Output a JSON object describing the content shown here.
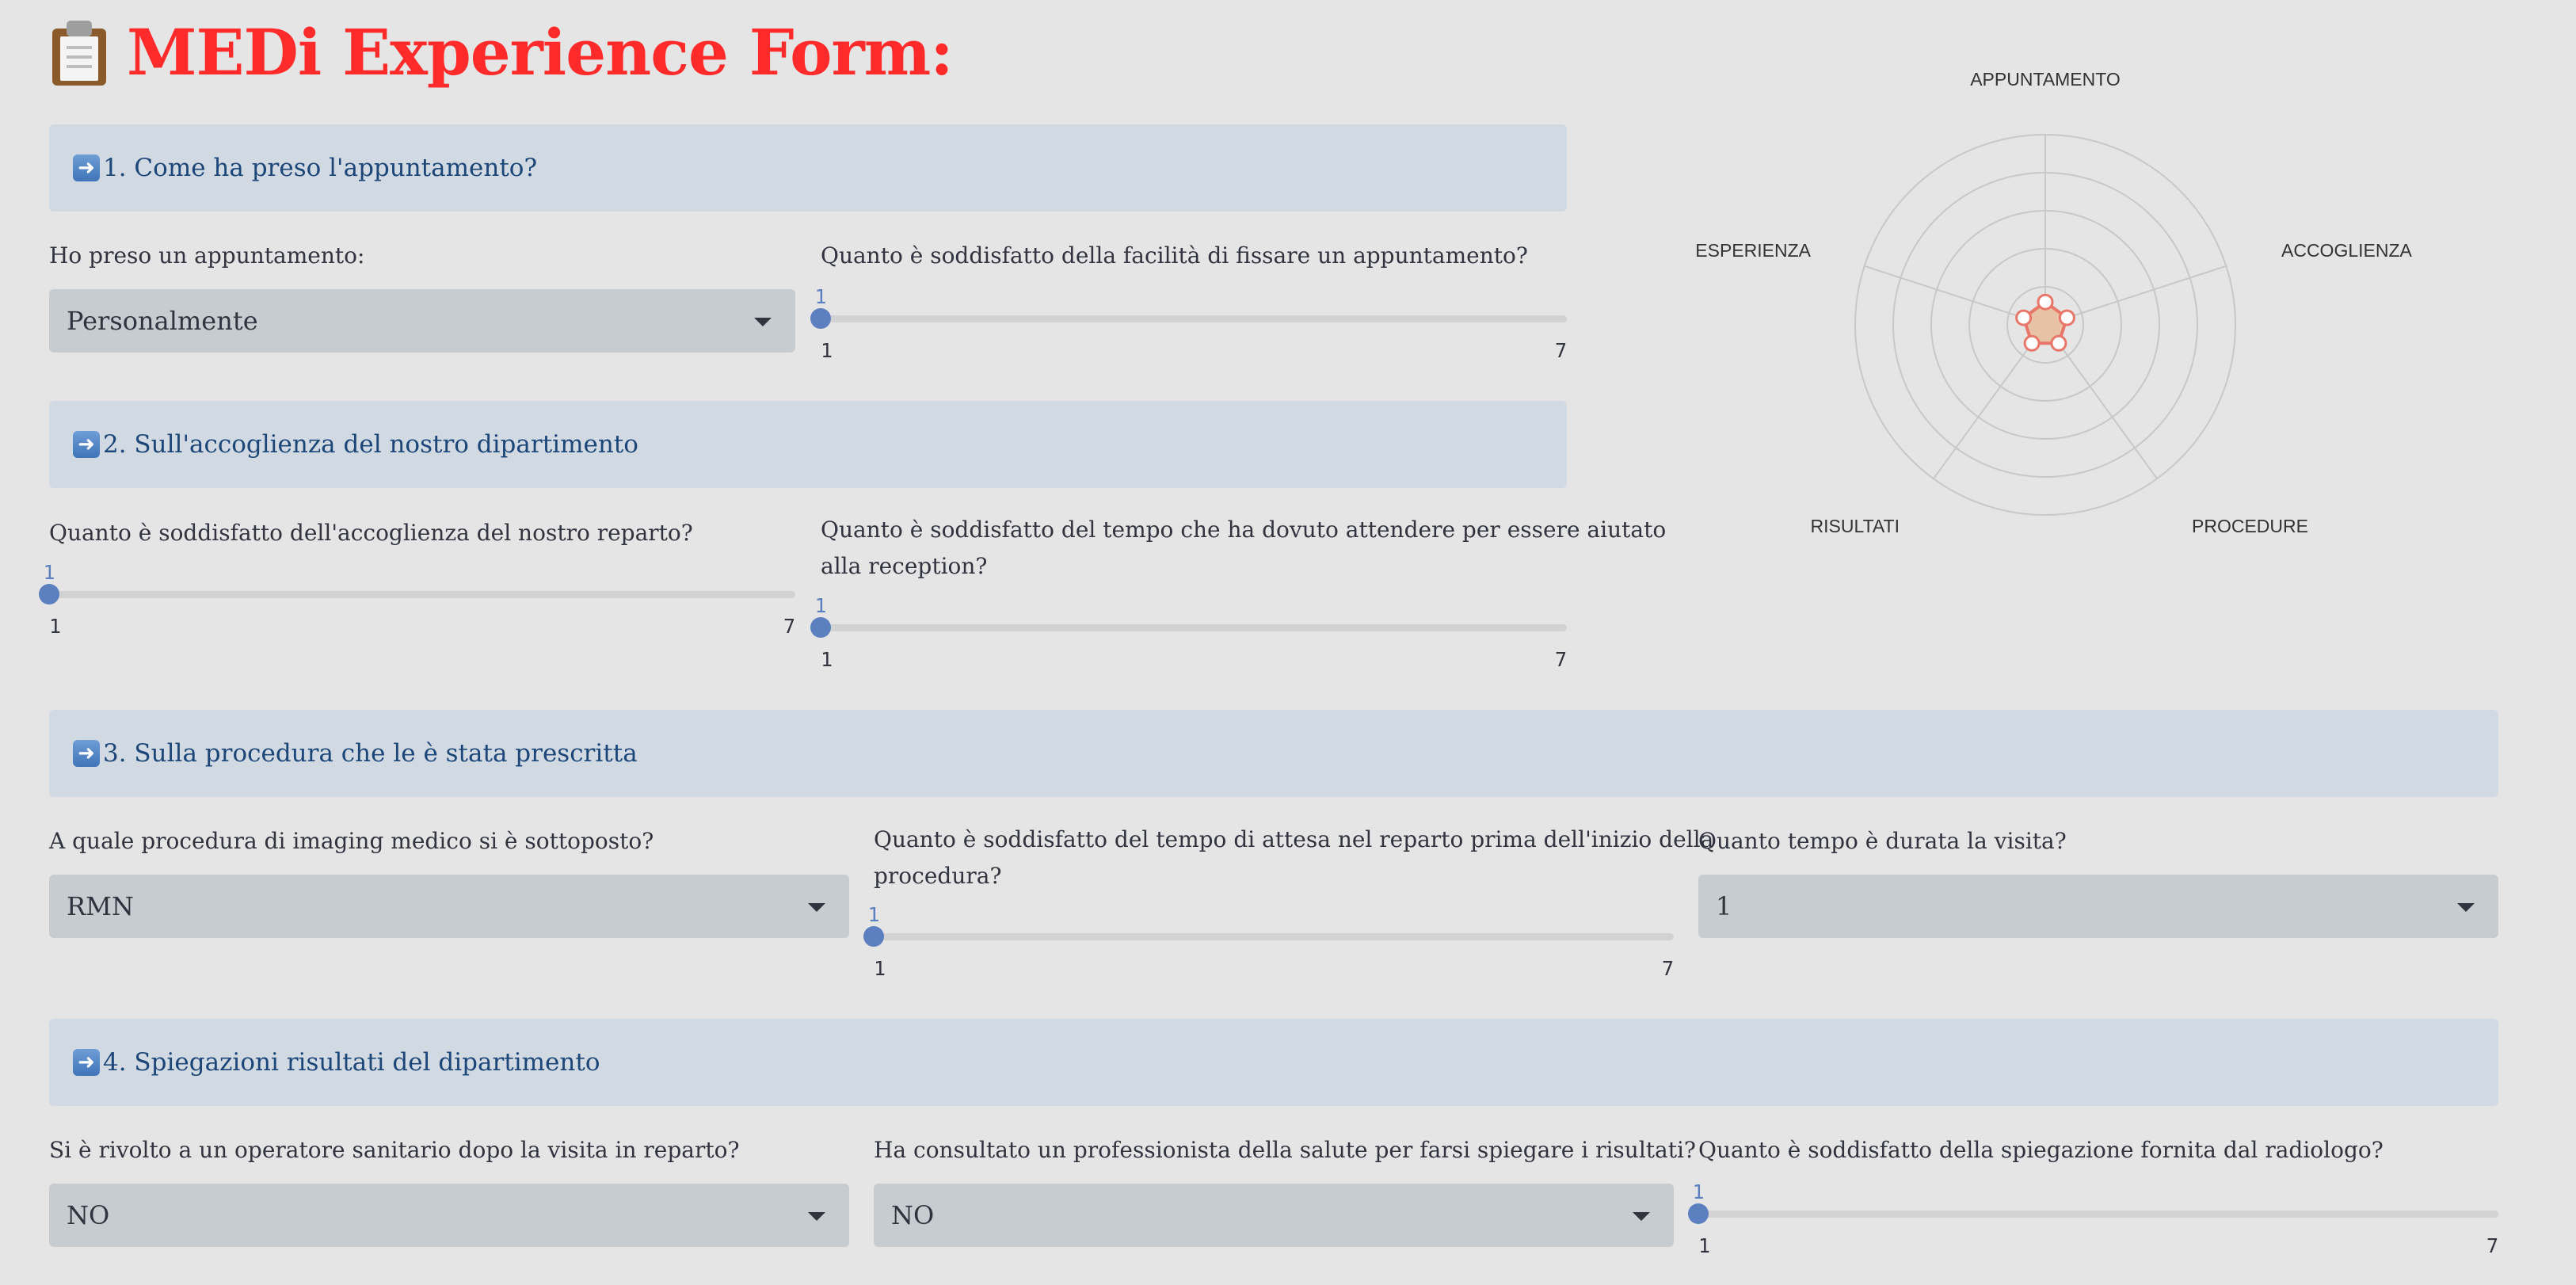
{
  "title": {
    "icon": "clipboard-icon",
    "text": "MEDi Experience Form:"
  },
  "sections": [
    {
      "icon": "right-arrow-icon",
      "label": "1. Come ha preso l'appuntamento?"
    },
    {
      "icon": "right-arrow-icon",
      "label": "2. Sull'accoglienza del nostro dipartimento"
    },
    {
      "icon": "right-arrow-icon",
      "label": "3. Sulla procedura che le è stata prescritta"
    },
    {
      "icon": "right-arrow-icon",
      "label": "4. Spiegazioni risultati del dipartimento"
    }
  ],
  "s1": {
    "select_label": "Ho preso un appuntamento:",
    "select_value": "Personalmente",
    "slider": {
      "label": "Quanto è soddisfatto della facilità di fissare un appuntamento?",
      "value": 1,
      "min": 1,
      "max": 7
    }
  },
  "s2": {
    "slider_a": {
      "label": "Quanto è soddisfatto dell'accoglienza del nostro reparto?",
      "value": 1,
      "min": 1,
      "max": 7
    },
    "slider_b": {
      "label_line1": "Quanto è soddisfatto del tempo che ha dovuto attendere per essere aiutato",
      "label_line2": "alla reception?",
      "value": 1,
      "min": 1,
      "max": 7
    }
  },
  "s3": {
    "select_label": "A quale procedura di imaging medico si è sottoposto?",
    "select_value": "RMN",
    "slider": {
      "label_line1": "Quanto è soddisfatto del tempo di attesa nel reparto prima dell'inizio della",
      "label_line2": "procedura?",
      "value": 1,
      "min": 1,
      "max": 7
    },
    "duration_label": "Quanto tempo è durata la visita?",
    "duration_value": "1"
  },
  "s4": {
    "select_a_label": "Si è rivolto a un operatore sanitario dopo la visita in reparto?",
    "select_a_value": "NO",
    "select_b_label": "Ha consultato un professionista della salute per farsi spiegare i risultati?",
    "select_b_value": "NO",
    "slider": {
      "label": "Quanto è soddisfatto della spiegazione fornita dal radiologo?",
      "value": 1,
      "min": 1,
      "max": 7
    }
  },
  "chart_data": {
    "type": "radar",
    "axes": [
      "APPUNTAMENTO",
      "ACCOGLIENZA",
      "PROCEDURE",
      "RISULTATI",
      "ESPERIENZA"
    ],
    "values": [
      1,
      1,
      1,
      1,
      1
    ],
    "range": [
      0,
      7
    ],
    "grid": true,
    "colors": {
      "fill": "#e8c2a4",
      "stroke": "#e8776a",
      "grid": "#c8c8c8"
    }
  }
}
